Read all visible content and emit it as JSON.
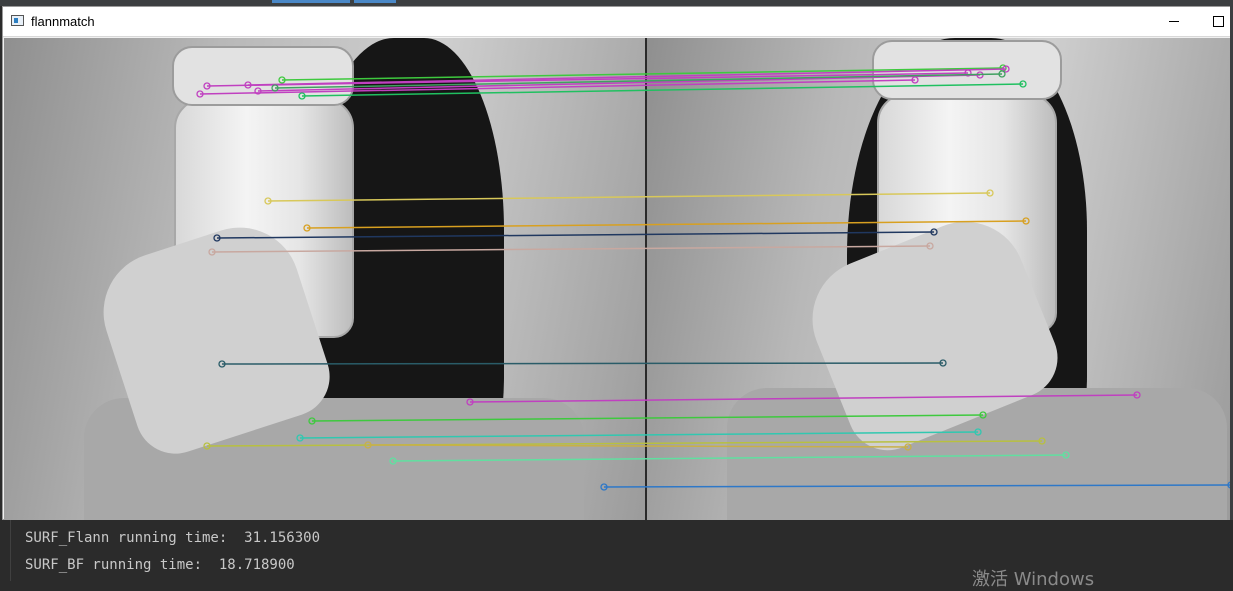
{
  "window": {
    "title": "flannmatch",
    "minimize": "minimize",
    "maximize": "maximize"
  },
  "console": {
    "lines": [
      "SURF_Flann running time:  31.156300",
      "SURF_BF running time:  18.718900"
    ]
  },
  "watermark": "激活 Windows",
  "colors": {
    "titlebar": "#ffffff",
    "console_bg": "#2b2b2b",
    "console_text": "#c8c8c8",
    "match_green": "#3ec93e",
    "match_magenta": "#c040c0",
    "match_yellow": "#d8c85a",
    "match_orange": "#d8a020",
    "match_navy": "#203860",
    "match_teal": "#2a5c68",
    "match_blue": "#2e78c8"
  },
  "matches": [
    {
      "color": "#3ec93e",
      "a": [
        282,
        80
      ],
      "b": [
        1003,
        68
      ]
    },
    {
      "color": "#c040c0",
      "a": [
        207,
        86
      ],
      "b": [
        968,
        73
      ]
    },
    {
      "color": "#c040c0",
      "a": [
        248,
        85
      ],
      "b": [
        1006,
        69
      ]
    },
    {
      "color": "#c040c0",
      "a": [
        258,
        91
      ],
      "b": [
        980,
        75
      ]
    },
    {
      "color": "#c040c0",
      "a": [
        200,
        94
      ],
      "b": [
        915,
        80
      ]
    },
    {
      "color": "#20c060",
      "a": [
        302,
        96
      ],
      "b": [
        1023,
        84
      ]
    },
    {
      "color": "#40a060",
      "a": [
        275,
        88
      ],
      "b": [
        1002,
        74
      ]
    },
    {
      "color": "#d8c85a",
      "a": [
        268,
        201
      ],
      "b": [
        990,
        193
      ]
    },
    {
      "color": "#d8a020",
      "a": [
        307,
        228
      ],
      "b": [
        1026,
        221
      ]
    },
    {
      "color": "#203860",
      "a": [
        217,
        238
      ],
      "b": [
        934,
        232
      ]
    },
    {
      "color": "#c8a8a0",
      "a": [
        212,
        252
      ],
      "b": [
        930,
        246
      ]
    },
    {
      "color": "#2a5c68",
      "a": [
        222,
        364
      ],
      "b": [
        943,
        363
      ]
    },
    {
      "color": "#c040c0",
      "a": [
        470,
        402
      ],
      "b": [
        1137,
        395
      ]
    },
    {
      "color": "#3ec93e",
      "a": [
        312,
        421
      ],
      "b": [
        983,
        415
      ]
    },
    {
      "color": "#30c8b0",
      "a": [
        300,
        438
      ],
      "b": [
        978,
        432
      ]
    },
    {
      "color": "#b8c040",
      "a": [
        207,
        446
      ],
      "b": [
        1042,
        441
      ]
    },
    {
      "color": "#c8b048",
      "a": [
        368,
        445
      ],
      "b": [
        908,
        447
      ]
    },
    {
      "color": "#60e0a0",
      "a": [
        393,
        461
      ],
      "b": [
        1066,
        455
      ]
    },
    {
      "color": "#2e78c8",
      "a": [
        604,
        487
      ],
      "b": [
        1231,
        485
      ]
    }
  ]
}
